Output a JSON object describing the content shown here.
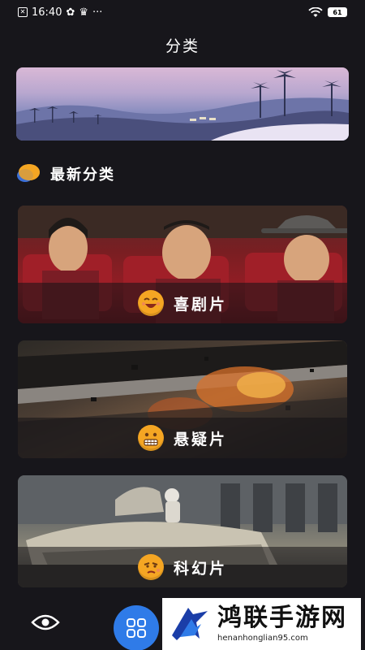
{
  "status_bar": {
    "time": "16:40",
    "battery": "61"
  },
  "header": {
    "title": "分类"
  },
  "banner": {
    "icon": "desert-landscape-banner"
  },
  "section": {
    "title": "最新分类",
    "icon": "chat-bubble-icon"
  },
  "categories": [
    {
      "label": "喜剧片",
      "icon": "laughing-face-icon"
    },
    {
      "label": "悬疑片",
      "icon": "grimacing-face-icon"
    },
    {
      "label": "科幻片",
      "icon": "squinting-face-icon"
    }
  ],
  "bottom_nav": {
    "items": [
      "eye-icon",
      "grid-icon"
    ]
  },
  "watermark": {
    "title": "鸿联手游网",
    "url": "henanhonglian95.com"
  },
  "colors": {
    "background": "#17161b",
    "accent": "#2f7be8",
    "emoji": "#f5a623"
  }
}
